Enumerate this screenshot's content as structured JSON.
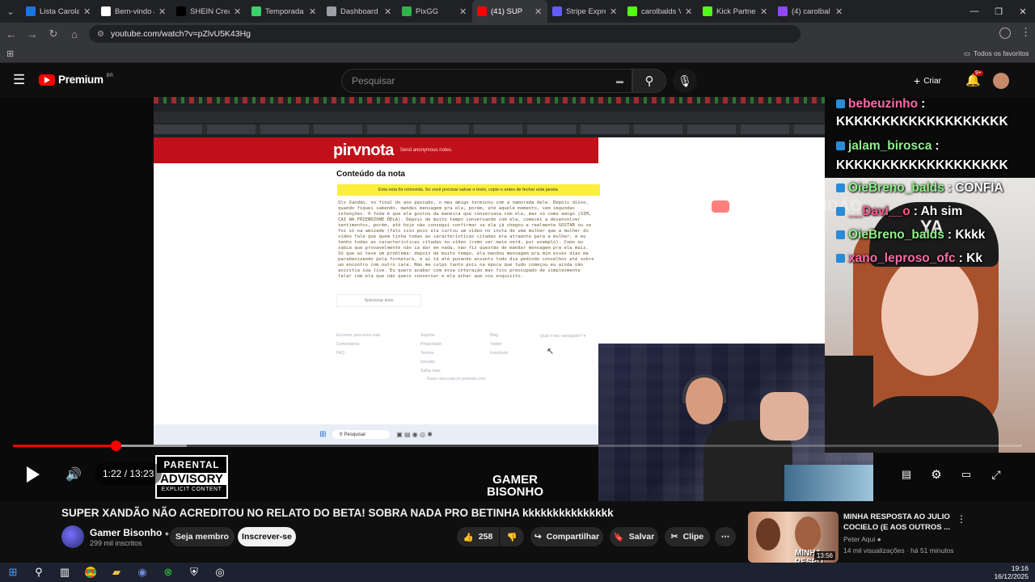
{
  "browser": {
    "tabs": [
      {
        "label": "Lista Carola",
        "color": "#1a73e8"
      },
      {
        "label": "Bem-vindo a",
        "color": "#ffffff"
      },
      {
        "label": "SHEIN Creat",
        "color": "#000000"
      },
      {
        "label": "Temporada",
        "color": "#3ccf6a"
      },
      {
        "label": "Dashboard",
        "color": "#9aa0a6"
      },
      {
        "label": "PixGG",
        "color": "#30b34a"
      },
      {
        "label": "(41) SUP",
        "color": "#ff0000"
      },
      {
        "label": "Stripe Expre",
        "color": "#635bff"
      },
      {
        "label": "carolbalds V",
        "color": "#53fc18"
      },
      {
        "label": "Kick Partner",
        "color": "#53fc18"
      },
      {
        "label": "(4) carolbal",
        "color": "#9146ff"
      }
    ],
    "url": "youtube.com/watch?v=pZlvU5K43Hg",
    "all_bookmarks": "Todos os favoritos"
  },
  "youtube": {
    "logo": "Premium",
    "region": "BR",
    "search_placeholder": "Pesquisar",
    "create_label": "Criar",
    "notif_count": "9+"
  },
  "stream": {
    "chat": [
      {
        "user": "bebeuzinho",
        "text": ":",
        "color": "pink"
      },
      {
        "user": "",
        "text": "KKKKKKKKKKKKKKKKKKK",
        "color": ""
      },
      {
        "user": "jalam_birosca",
        "text": ":",
        "color": "green"
      },
      {
        "user": "",
        "text": "KKKKKKKKKKKKKKKKKKK",
        "color": ""
      },
      {
        "user": "OieBreno_balds",
        "text": ": CONFIA",
        "color": "green"
      },
      {
        "user": "__Davi__o",
        "text": ": Ah sim",
        "color": "red"
      },
      {
        "user": "OieBreno_balds",
        "text": ": Kkkk",
        "color": "green"
      },
      {
        "user": "xano_leproso_ofc",
        "text": ": Kk",
        "color": "pink"
      }
    ],
    "watermark": "/SUPER XANDÃO",
    "site_logo": "pirvnota",
    "site_tagline": "Send anonymous notes.",
    "note_title": "Conteúdo da nota",
    "note_warning": "Esta nota foi removida. Se você precisar salvar o texto, copie-o antes de fechar esta janela.",
    "note_text": "Slv Xandão, no final do ano passado, o meu amigo terminou com a namorada dele. Depois disso, quando fiquei sabendo, mandei mensagem pra ela, porém, até aquele momento, sem segundas intenções. O foda é que ela gostou da maneira que conversava com ela, mas só como amigo (SIM, CAI NA FRIENDZONE DELA). Depois de muito tempo conversando com ela, comecei a desenvolver sentimentos, porém, até hoje não consegui confirmar se ela já chegou a realmente GOSTAR ou se foi só na amizade (falo isso pois ela curtiu um vídeo no insta de uma mulher que a mulher do vídeo fala que quem tinha todas as características citadas era atraente para a mulher, e eu tenho todas as características citadas no vídeo (como ser meio nerd, por exemplo). Como eu sabia que provavelmente não ia dar em nada, não fiz questão de mandar mensagem pra ela mais. Só que aí teve um problema: depois de muito tempo, ela mandou mensagem pra mim esses dias me parabenizando pela formatura, e aí tá até puxando assunto todo dia pedindo conselhos até sobre um encontro com outro cara. Não me culpo tanto pois na época que tudo começou eu ainda não assistia sua live. Eu quero acabar com essa interação mas fico preocupado de simplesmente falar com ela que não quero conversar e ela achar que sou esquisito.",
    "select_text": "Selecionar texto",
    "footer_col1": [
      "Escrever uma nova nota",
      "Comentários",
      "FAQ"
    ],
    "footer_col2": [
      "Suporte",
      "Privacidade",
      "Termos",
      "Security",
      "Saiba mais"
    ],
    "footer_col3": [
      "Blog",
      "Twitter",
      "Facebook"
    ],
    "footer_lang": "Qual o seu navegador? ▾",
    "footer_note": "Fazer uma nota on privnote.com",
    "taskbar_search": "Pesquisar",
    "parental": [
      "PARENTAL",
      "ADVISORY",
      "EXPLICIT CONTENT"
    ],
    "channel_logo": "GAMER BISONHO"
  },
  "player": {
    "current_time": "1:22",
    "duration": "13:23",
    "time_display": "1:22 / 13:23",
    "played_fraction": 0.102,
    "buffered_fraction": 0.172
  },
  "video": {
    "title": "SUPER XANDÃO NÃO ACREDITOU NO RELATO DO BETA! SOBRA NADA PRO BETINHA kkkkkkkkkkkkkkk",
    "channel": "Gamer Bisonho",
    "subscribers": "299 mil inscritos",
    "member_label": "Seja membro",
    "subscribe_label": "Inscrever-se",
    "likes": "258",
    "share_label": "Compartilhar",
    "save_label": "Salvar",
    "clip_label": "Clipe"
  },
  "recommendation": {
    "title": "MINHA RESPOSTA AO JULIO COCIELO (E AOS OUTROS ...",
    "channel": "Peter Aqui",
    "meta": "14 mil visualizações · há 51 minutos",
    "duration": "13:56",
    "thumb_text": "MINHA RESPO"
  },
  "taskbar": {
    "time": "19:16",
    "date": "16/12/2025"
  }
}
